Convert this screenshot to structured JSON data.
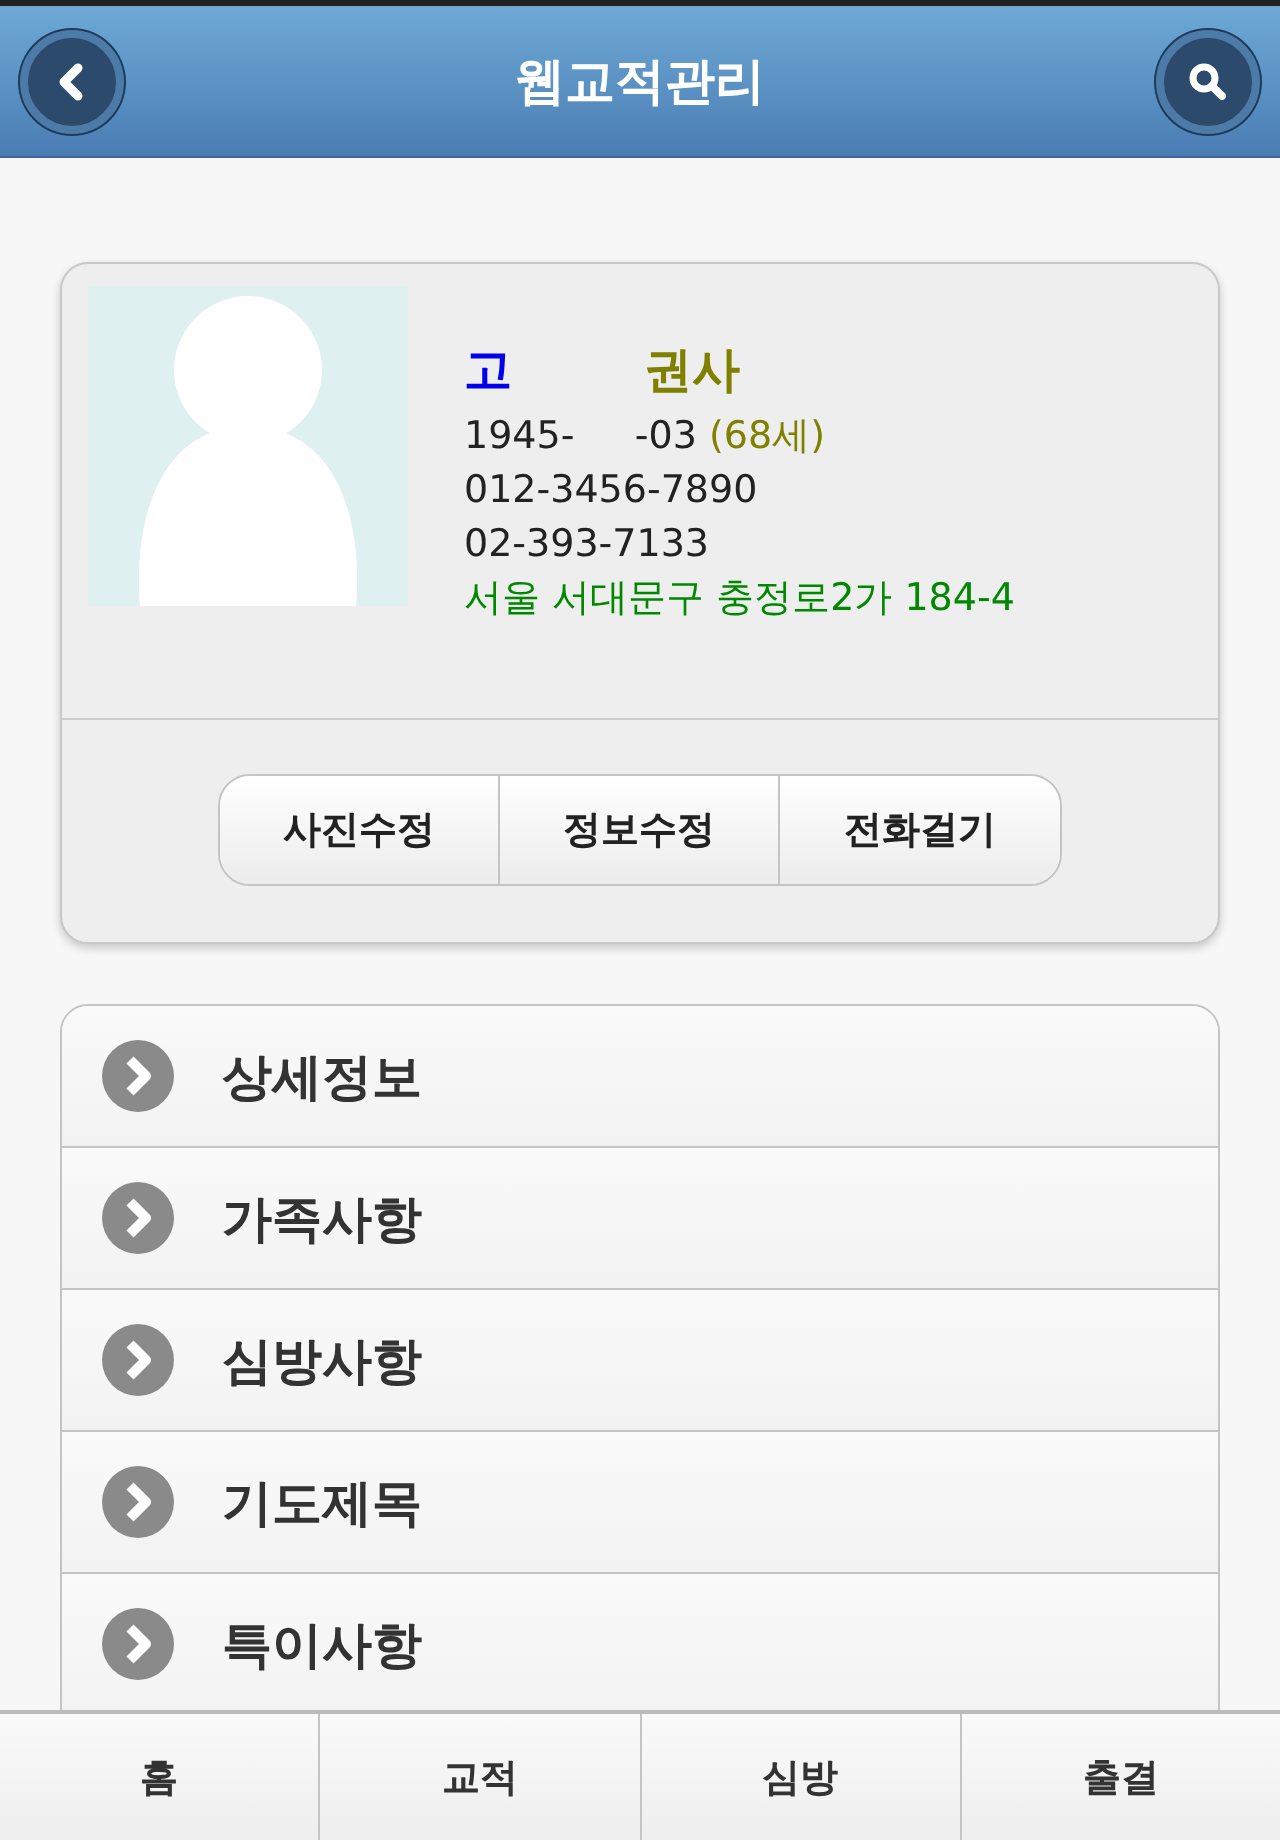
{
  "header": {
    "title": "웹교적관리"
  },
  "profile": {
    "name_prefix": "고",
    "title": "권사",
    "birth": "1945-     -03",
    "age": "(68세)",
    "mobile": "012-3456-7890",
    "phone": "02-393-7133",
    "address": "서울 서대문구 충정로2가 184-4"
  },
  "actions": [
    "사진수정",
    "정보수정",
    "전화걸기"
  ],
  "menu": [
    {
      "label": "상세정보"
    },
    {
      "label": "가족사항"
    },
    {
      "label": "심방사항"
    },
    {
      "label": "기도제목"
    },
    {
      "label": "특이사항"
    }
  ],
  "tabs": [
    "홈",
    "교적",
    "심방",
    "출결"
  ]
}
